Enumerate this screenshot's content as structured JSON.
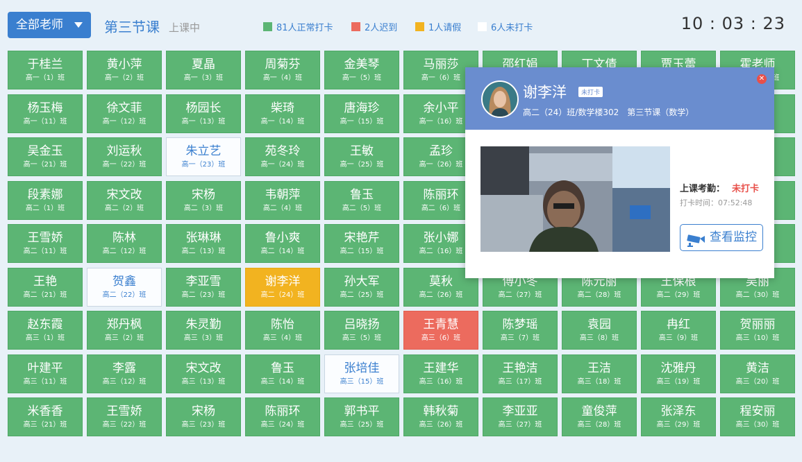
{
  "header": {
    "teacher_select": "全部老师",
    "period_title": "第三节课",
    "period_status": "上课中",
    "clock": "10 : 03 : 23",
    "legend": [
      {
        "label": "81人正常打卡",
        "color": "#5cb574"
      },
      {
        "label": "2人迟到",
        "color": "#ec6b5e"
      },
      {
        "label": "1人请假",
        "color": "#f2b320"
      },
      {
        "label": "6人未打卡",
        "color": "#ffffff"
      }
    ]
  },
  "teachers": [
    {
      "name": "于桂兰",
      "cls": "高一（1）班",
      "status": "normal"
    },
    {
      "name": "黄小萍",
      "cls": "高一（2）班",
      "status": "normal"
    },
    {
      "name": "夏晶",
      "cls": "高一（3）班",
      "status": "normal"
    },
    {
      "name": "周菊芬",
      "cls": "高一（4）班",
      "status": "normal"
    },
    {
      "name": "金美琴",
      "cls": "高一（5）班",
      "status": "normal"
    },
    {
      "name": "马丽莎",
      "cls": "高一（6）班",
      "status": "normal"
    },
    {
      "name": "邵红娟",
      "cls": "高一（7）班",
      "status": "normal"
    },
    {
      "name": "丁文倩",
      "cls": "高一（8）班",
      "status": "normal"
    },
    {
      "name": "贾玉蕾",
      "cls": "高一（9）班",
      "status": "normal"
    },
    {
      "name": "霍老师",
      "cls": "高一（10）班",
      "status": "normal"
    },
    {
      "name": "杨玉梅",
      "cls": "高一（11）班",
      "status": "normal"
    },
    {
      "name": "徐文菲",
      "cls": "高一（12）班",
      "status": "normal"
    },
    {
      "name": "杨园长",
      "cls": "高一（13）班",
      "status": "normal"
    },
    {
      "name": "柴琦",
      "cls": "高一（14）班",
      "status": "normal"
    },
    {
      "name": "唐海珍",
      "cls": "高一（15）班",
      "status": "normal"
    },
    {
      "name": "余小平",
      "cls": "高一（16）班",
      "status": "normal"
    },
    {
      "name": "",
      "cls": "",
      "status": "normal"
    },
    {
      "name": "",
      "cls": "",
      "status": "normal"
    },
    {
      "name": "",
      "cls": "",
      "status": "normal"
    },
    {
      "name": "",
      "cls": "",
      "status": "normal"
    },
    {
      "name": "吴金玉",
      "cls": "高一（21）班",
      "status": "normal"
    },
    {
      "name": "刘运秋",
      "cls": "高一（22）班",
      "status": "normal"
    },
    {
      "name": "朱立艺",
      "cls": "高一（23）班",
      "status": "absent"
    },
    {
      "name": "苑冬玲",
      "cls": "高一（24）班",
      "status": "normal"
    },
    {
      "name": "王敏",
      "cls": "高一（25）班",
      "status": "normal"
    },
    {
      "name": "孟珍",
      "cls": "高一（26）班",
      "status": "normal"
    },
    {
      "name": "",
      "cls": "",
      "status": "normal"
    },
    {
      "name": "",
      "cls": "",
      "status": "normal"
    },
    {
      "name": "",
      "cls": "",
      "status": "normal"
    },
    {
      "name": "",
      "cls": "",
      "status": "normal"
    },
    {
      "name": "段素娜",
      "cls": "高二（1）班",
      "status": "normal"
    },
    {
      "name": "宋文改",
      "cls": "高二（2）班",
      "status": "normal"
    },
    {
      "name": "宋杨",
      "cls": "高二（3）班",
      "status": "normal"
    },
    {
      "name": "韦朝萍",
      "cls": "高二（4）班",
      "status": "normal"
    },
    {
      "name": "鲁玉",
      "cls": "高二（5）班",
      "status": "normal"
    },
    {
      "name": "陈丽环",
      "cls": "高二（6）班",
      "status": "normal"
    },
    {
      "name": "",
      "cls": "",
      "status": "normal"
    },
    {
      "name": "",
      "cls": "",
      "status": "normal"
    },
    {
      "name": "",
      "cls": "",
      "status": "normal"
    },
    {
      "name": "",
      "cls": "",
      "status": "normal"
    },
    {
      "name": "王雪娇",
      "cls": "高二（11）班",
      "status": "normal"
    },
    {
      "name": "陈林",
      "cls": "高二（12）班",
      "status": "normal"
    },
    {
      "name": "张琳琳",
      "cls": "高二（13）班",
      "status": "normal"
    },
    {
      "name": "鲁小爽",
      "cls": "高二（14）班",
      "status": "normal"
    },
    {
      "name": "宋艳芹",
      "cls": "高二（15）班",
      "status": "normal"
    },
    {
      "name": "张小娜",
      "cls": "高二（16）班",
      "status": "normal"
    },
    {
      "name": "",
      "cls": "",
      "status": "normal"
    },
    {
      "name": "",
      "cls": "",
      "status": "normal"
    },
    {
      "name": "",
      "cls": "",
      "status": "normal"
    },
    {
      "name": "",
      "cls": "",
      "status": "normal"
    },
    {
      "name": "王艳",
      "cls": "高二（21）班",
      "status": "normal"
    },
    {
      "name": "贺鑫",
      "cls": "高二（22）班",
      "status": "absent"
    },
    {
      "name": "李亚雪",
      "cls": "高二（23）班",
      "status": "normal"
    },
    {
      "name": "谢李洋",
      "cls": "高二（24）班",
      "status": "leave"
    },
    {
      "name": "孙大军",
      "cls": "高二（25）班",
      "status": "normal"
    },
    {
      "name": "莫秋",
      "cls": "高二（26）班",
      "status": "normal"
    },
    {
      "name": "傅小冬",
      "cls": "高二（27）班",
      "status": "normal"
    },
    {
      "name": "陈元丽",
      "cls": "高二（28）班",
      "status": "normal"
    },
    {
      "name": "王保根",
      "cls": "高二（29）班",
      "status": "normal"
    },
    {
      "name": "吴丽",
      "cls": "高二（30）班",
      "status": "normal"
    },
    {
      "name": "赵东霞",
      "cls": "高三（1）班",
      "status": "normal"
    },
    {
      "name": "郑丹枫",
      "cls": "高三（2）班",
      "status": "normal"
    },
    {
      "name": "朱灵勤",
      "cls": "高三（3）班",
      "status": "normal"
    },
    {
      "name": "陈怡",
      "cls": "高三（4）班",
      "status": "normal"
    },
    {
      "name": "吕晓扬",
      "cls": "高三（5）班",
      "status": "normal"
    },
    {
      "name": "王青慧",
      "cls": "高三（6）班",
      "status": "late"
    },
    {
      "name": "陈梦瑶",
      "cls": "高三（7）班",
      "status": "normal"
    },
    {
      "name": "袁园",
      "cls": "高三（8）班",
      "status": "normal"
    },
    {
      "name": "冉红",
      "cls": "高三（9）班",
      "status": "normal"
    },
    {
      "name": "贺丽丽",
      "cls": "高三（10）班",
      "status": "normal"
    },
    {
      "name": "叶建平",
      "cls": "高三（11）班",
      "status": "normal"
    },
    {
      "name": "李露",
      "cls": "高三（12）班",
      "status": "normal"
    },
    {
      "name": "宋文改",
      "cls": "高三（13）班",
      "status": "normal"
    },
    {
      "name": "鲁玉",
      "cls": "高三（14）班",
      "status": "normal"
    },
    {
      "name": "张培佳",
      "cls": "高三（15）班",
      "status": "absent"
    },
    {
      "name": "王建华",
      "cls": "高三（16）班",
      "status": "normal"
    },
    {
      "name": "王艳洁",
      "cls": "高三（17）班",
      "status": "normal"
    },
    {
      "name": "王洁",
      "cls": "高三（18）班",
      "status": "normal"
    },
    {
      "name": "沈雅丹",
      "cls": "高三（19）班",
      "status": "normal"
    },
    {
      "name": "黄洁",
      "cls": "高三（20）班",
      "status": "normal"
    },
    {
      "name": "米香香",
      "cls": "高三（21）班",
      "status": "normal"
    },
    {
      "name": "王雪娇",
      "cls": "高三（22）班",
      "status": "normal"
    },
    {
      "name": "宋杨",
      "cls": "高三（23）班",
      "status": "normal"
    },
    {
      "name": "陈丽环",
      "cls": "高三（24）班",
      "status": "normal"
    },
    {
      "name": "郭书平",
      "cls": "高三（25）班",
      "status": "normal"
    },
    {
      "name": "韩秋菊",
      "cls": "高三（26）班",
      "status": "normal"
    },
    {
      "name": "李亚亚",
      "cls": "高三（27）班",
      "status": "normal"
    },
    {
      "name": "童俊萍",
      "cls": "高三（28）班",
      "status": "normal"
    },
    {
      "name": "张泽东",
      "cls": "高三（29）班",
      "status": "normal"
    },
    {
      "name": "程安丽",
      "cls": "高三（30）班",
      "status": "normal"
    }
  ],
  "popup": {
    "name": "谢李洋",
    "tag": "未打卡",
    "info": "高二（24）班/数学楼302　第三节课（数学）",
    "attendance_label": "上课考勤：",
    "attendance_value": "未打卡",
    "punch_time": "打卡时间：07:52:48",
    "monitor_button": "查看监控",
    "close_icon": "close-icon",
    "camera_icon": "camera-icon",
    "avatar_icon": "avatar"
  }
}
